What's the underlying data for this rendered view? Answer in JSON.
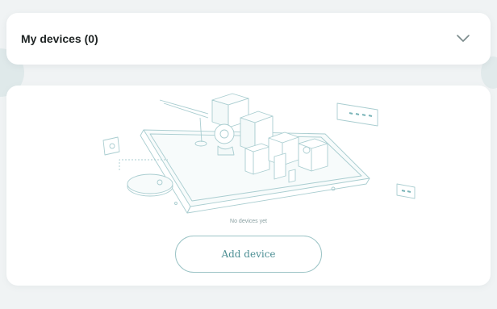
{
  "header": {
    "title": "My devices (0)",
    "chevron_icon": "chevron-down-icon"
  },
  "empty_state": {
    "illustration_icon": "smart-home-devices-illustration",
    "message": "No devices yet",
    "add_button_label": "Add device"
  },
  "colors": {
    "accent": "#4d8f94",
    "accent_border": "#9cc4c6",
    "background": "#f0f3f4",
    "card": "#ffffff",
    "text_dark": "#1f2424",
    "text_muted": "#8aa0a2"
  }
}
